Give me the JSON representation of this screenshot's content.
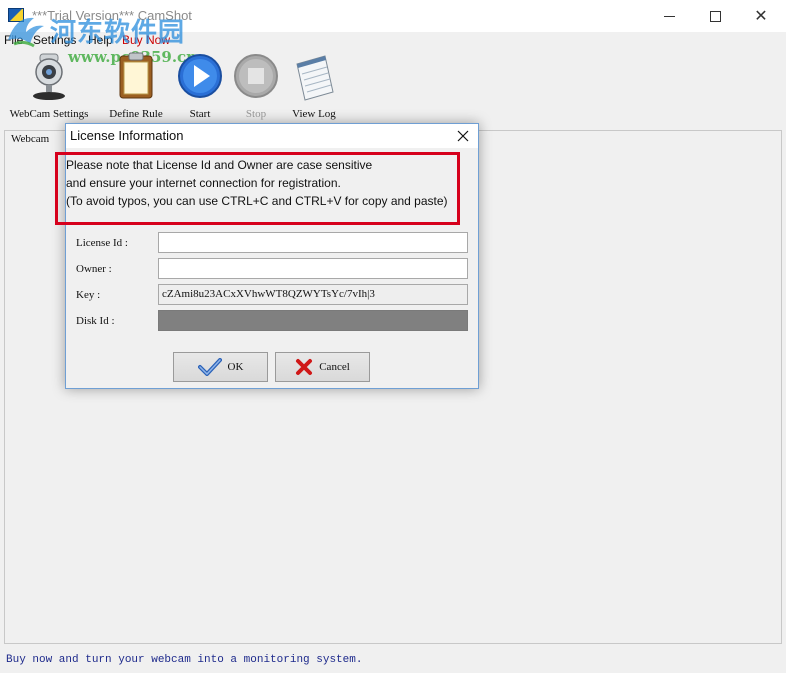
{
  "window": {
    "title": "***Trial Version*** CamShot",
    "minimize_glyph": "minimize-icon",
    "maximize_glyph": "maximize-icon",
    "close_glyph": "✕"
  },
  "watermark": {
    "chinese": "河东软件园",
    "url": "www.pc0359.cn"
  },
  "menu": {
    "items": [
      "File",
      "Settings",
      "Help"
    ],
    "buy": "Buy Now"
  },
  "toolbar": {
    "webcam_settings": "WebCam Settings",
    "define_rule": "Define Rule",
    "start": "Start",
    "stop": "Stop",
    "view_log": "View Log"
  },
  "main": {
    "webcam_label": "Webcam"
  },
  "status": {
    "text": "Buy now and turn your webcam into a monitoring system."
  },
  "dialog": {
    "title": "License Information",
    "close": "✕",
    "note": [
      "Please note that License Id and Owner are case sensitive",
      "and ensure your internet connection for registration.",
      "(To avoid typos, you can use CTRL+C and CTRL+V for copy and paste)"
    ],
    "fields": {
      "license_label": "License Id :",
      "license_value": "",
      "owner_label": "Owner :",
      "owner_value": "",
      "key_label": "Key :",
      "key_value": "cZAmi8u23ACxXVhwWT8QZWYTsYc/7vIh|3",
      "disk_label": "Disk Id :",
      "disk_value": ""
    },
    "ok_label": "OK",
    "cancel_label": "Cancel"
  },
  "colors": {
    "accent_red": "#d6001c",
    "status_blue": "#1e2a8c",
    "buy_red": "#cc0000"
  }
}
